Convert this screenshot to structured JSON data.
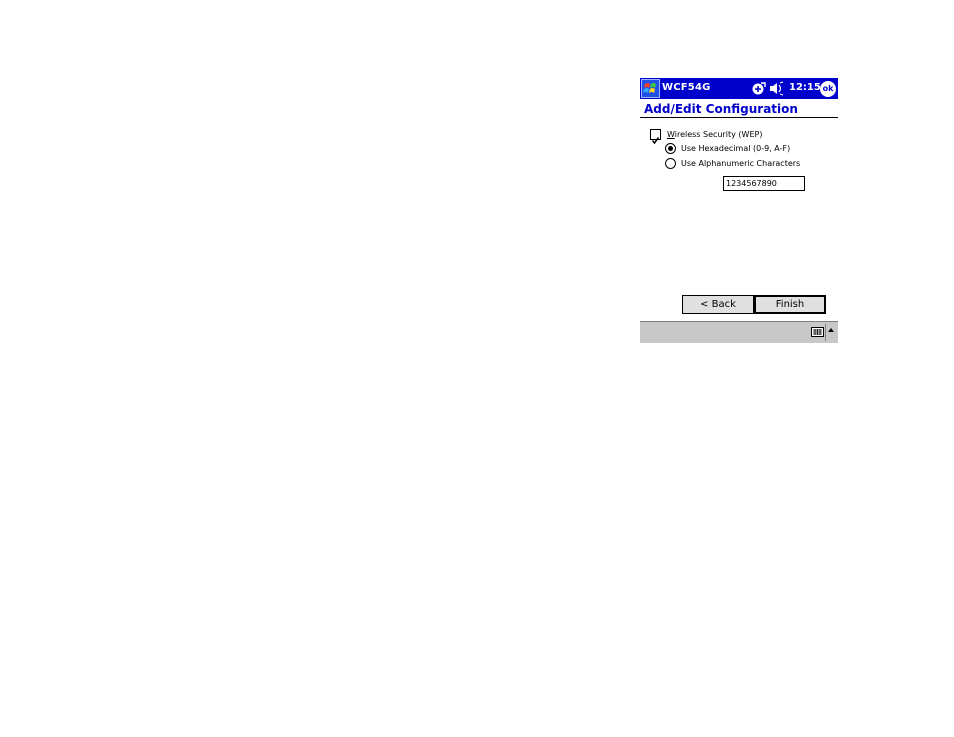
{
  "titlebar": {
    "app_title": "WCF54G",
    "time": "12:15",
    "ok_label": "ok"
  },
  "page": {
    "heading": "Add/Edit Configuration"
  },
  "security": {
    "wep_label": "Wireless Security (WEP)",
    "wep_checked": true,
    "hex_label": "Use Hexadecimal (0-9, A-F)",
    "alnum_label": "Use Alphanumeric Characters",
    "selected": "hex",
    "key_value": "1234567890"
  },
  "buttons": {
    "back_label": "< Back",
    "finish_label": "Finish"
  },
  "colors": {
    "titlebar": "#0000cc",
    "heading": "#0000cc",
    "command_bar": "#c8c8c8"
  },
  "icons": {
    "start": "windows-flag-icon",
    "connectivity": "connectivity-icon",
    "volume": "speaker-icon",
    "sip": "keyboard-icon",
    "sip_menu": "up-arrow-icon"
  }
}
